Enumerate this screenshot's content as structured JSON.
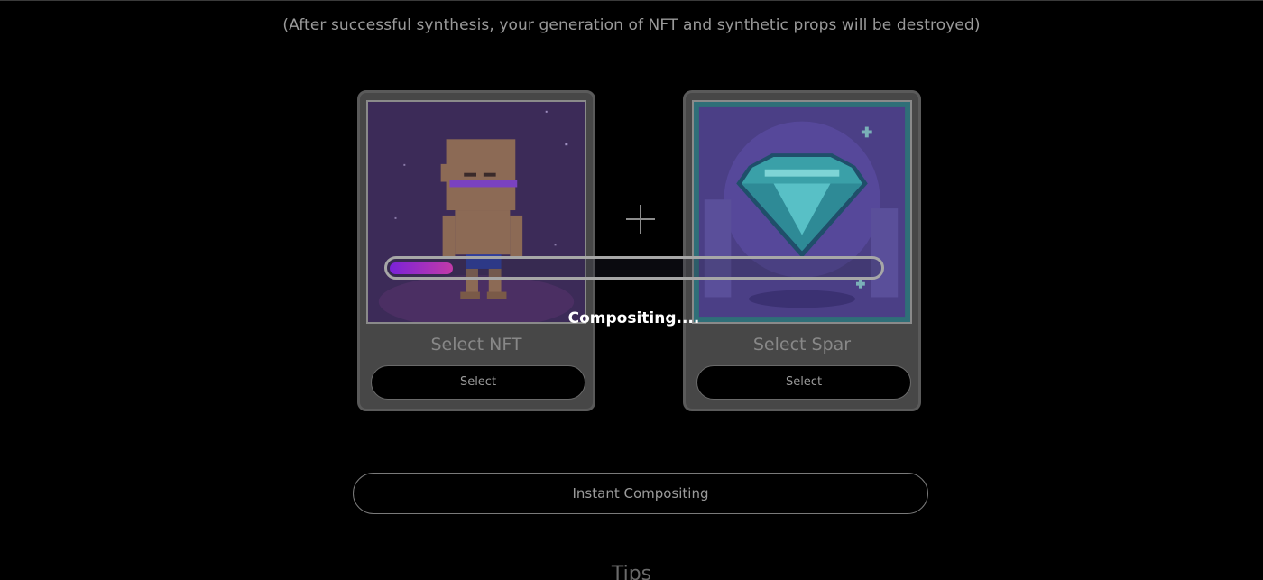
{
  "notice": "(After successful synthesis, your generation of NFT and synthetic props will be destroyed)",
  "cards": [
    {
      "title": "Select NFT",
      "button_label": "Select",
      "image_icon": "pixel-character-icon"
    },
    {
      "title": "Select Spar",
      "button_label": "Select",
      "image_icon": "pixel-diamond-icon"
    }
  ],
  "plus_icon": "plus-icon",
  "progress": {
    "fraction": 0.13,
    "status_text": "Compositing....",
    "fill_colors": [
      "#7a22d8",
      "#c23aa8"
    ]
  },
  "instant_button_label": "Instant Compositing",
  "tips_heading": "Tips"
}
